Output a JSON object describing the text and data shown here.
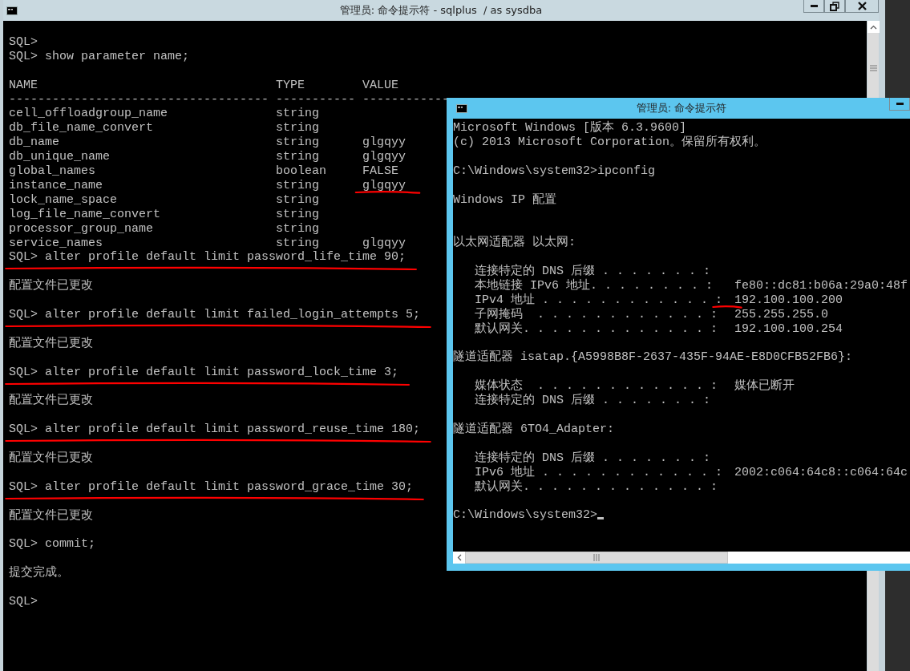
{
  "windows": [
    {
      "kind": "sqlplus",
      "title": "管理员: 命令提示符 - sqlplus  / as sysdba",
      "active": false,
      "controls": [
        {
          "kind": "minimize"
        },
        {
          "kind": "restore"
        },
        {
          "kind": "close"
        }
      ],
      "lines": [
        {
          "kind": "blank"
        },
        {
          "kind": "text",
          "text": "SQL>"
        },
        {
          "kind": "text",
          "text": "SQL> show parameter name;"
        },
        {
          "kind": "blank"
        },
        {
          "kind": "table",
          "columns": [
            "NAME",
            "TYPE",
            "VALUE"
          ],
          "separator": "------------------------------------ ----------- ------------",
          "rows": [
            {
              "cells": [
                "cell_offloadgroup_name",
                "string"
              ]
            },
            {
              "cells": [
                "db_file_name_convert",
                "string"
              ]
            },
            {
              "cells": [
                "db_name",
                "string",
                "glgqyy"
              ]
            },
            {
              "cells": [
                "db_unique_name",
                "string",
                "glgqyy"
              ]
            },
            {
              "cells": [
                "global_names",
                "boolean",
                "FALSE"
              ]
            },
            {
              "cells": [
                "instance_name",
                "string",
                "glgqyy"
              ],
              "annotated": true
            },
            {
              "cells": [
                "lock_name_space",
                "string"
              ]
            },
            {
              "cells": [
                "log_file_name_convert",
                "string"
              ]
            },
            {
              "cells": [
                "processor_group_name",
                "string"
              ]
            },
            {
              "cells": [
                "service_names",
                "string",
                "glgqyy"
              ]
            }
          ]
        },
        {
          "kind": "text",
          "text": "SQL> alter profile default limit password_life_time 90;",
          "annotated": true
        },
        {
          "kind": "blank"
        },
        {
          "kind": "text",
          "text": "配置文件已更改"
        },
        {
          "kind": "blank"
        },
        {
          "kind": "text",
          "text": "SQL> alter profile default limit failed_login_attempts 5;",
          "annotated": true
        },
        {
          "kind": "blank"
        },
        {
          "kind": "text",
          "text": "配置文件已更改"
        },
        {
          "kind": "blank"
        },
        {
          "kind": "text",
          "text": "SQL> alter profile default limit password_lock_time 3;",
          "annotated": true
        },
        {
          "kind": "blank"
        },
        {
          "kind": "text",
          "text": "配置文件已更改"
        },
        {
          "kind": "blank"
        },
        {
          "kind": "text",
          "text": "SQL> alter profile default limit password_reuse_time 180;",
          "annotated": true
        },
        {
          "kind": "blank"
        },
        {
          "kind": "text",
          "text": "配置文件已更改"
        },
        {
          "kind": "blank"
        },
        {
          "kind": "text",
          "text": "SQL> alter profile default limit password_grace_time 30;",
          "annotated": true
        },
        {
          "kind": "blank"
        },
        {
          "kind": "text",
          "text": "配置文件已更改"
        },
        {
          "kind": "blank"
        },
        {
          "kind": "text",
          "text": "SQL> commit;"
        },
        {
          "kind": "blank"
        },
        {
          "kind": "text",
          "text": "提交完成。"
        },
        {
          "kind": "blank"
        },
        {
          "kind": "text",
          "text": "SQL>"
        }
      ]
    },
    {
      "kind": "cmd",
      "title": "管理员: 命令提示符",
      "active": true,
      "controls": [
        {
          "kind": "minimize"
        }
      ],
      "lines": [
        {
          "kind": "text",
          "text": "Microsoft Windows [版本 6.3.9600]"
        },
        {
          "kind": "text",
          "text": "(c) 2013 Microsoft Corporation。保留所有权利。"
        },
        {
          "kind": "blank"
        },
        {
          "kind": "text",
          "text": "C:\\Windows\\system32>ipconfig"
        },
        {
          "kind": "blank"
        },
        {
          "kind": "text",
          "text": "Windows IP 配置"
        },
        {
          "kind": "blank"
        },
        {
          "kind": "blank"
        },
        {
          "kind": "text",
          "text": "以太网适配器 以太网:"
        },
        {
          "kind": "blank"
        },
        {
          "kind": "entry",
          "label": "连接特定的 DNS 后缀 . . . . . . . :"
        },
        {
          "kind": "entry",
          "label": "本地链接 IPv6 地址. . . . . . . . :",
          "value": "fe80::dc81:b06a:29a0:48f"
        },
        {
          "kind": "entry",
          "label": "IPv4 地址 . . . . . . . . . . . . :",
          "value": "192.100.100.200",
          "annotated": true
        },
        {
          "kind": "entry",
          "label": "子网掩码  . . . . . . . . . . . . :",
          "value": "255.255.255.0"
        },
        {
          "kind": "entry",
          "label": "默认网关. . . . . . . . . . . . . :",
          "value": "192.100.100.254"
        },
        {
          "kind": "blank"
        },
        {
          "kind": "text",
          "text": "隧道适配器 isatap.{A5998B8F-2637-435F-94AE-E8D0CFB52FB6}:"
        },
        {
          "kind": "blank"
        },
        {
          "kind": "entry",
          "label": "媒体状态  . . . . . . . . . . . . :",
          "value": "媒体已断开"
        },
        {
          "kind": "entry",
          "label": "连接特定的 DNS 后缀 . . . . . . . :"
        },
        {
          "kind": "blank"
        },
        {
          "kind": "text",
          "text": "隧道适配器 6TO4_Adapter:"
        },
        {
          "kind": "blank"
        },
        {
          "kind": "entry",
          "label": "连接特定的 DNS 后缀 . . . . . . . :"
        },
        {
          "kind": "entry",
          "label": "IPv6 地址 . . . . . . . . . . . . :",
          "value": "2002:c064:64c8::c064:64c"
        },
        {
          "kind": "entry",
          "label": "默认网关. . . . . . . . . . . . . :"
        },
        {
          "kind": "blank"
        },
        {
          "kind": "text",
          "text": "C:\\Windows\\system32>",
          "cursor": true
        }
      ]
    }
  ]
}
